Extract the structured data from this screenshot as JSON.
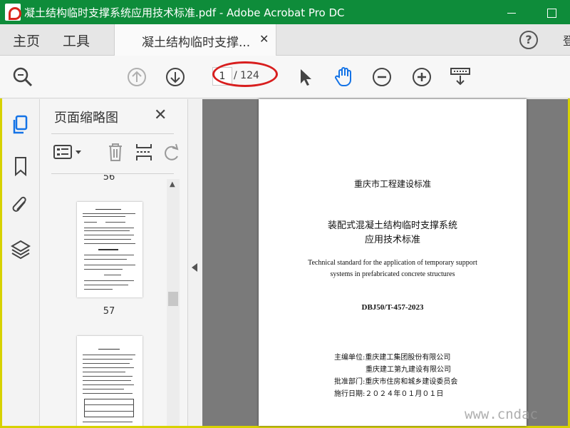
{
  "window": {
    "title": "凝土结构临时支撑系统应用技术标准.pdf - Adobe Acrobat Pro DC"
  },
  "menu": {
    "home": "主页",
    "tools": "工具",
    "doc_tab": "凝土结构临时支撑...",
    "help": "?",
    "login": "登"
  },
  "toolbar": {
    "page_input": "1",
    "page_total": "/ 124"
  },
  "panel": {
    "title": "页面缩略图",
    "close": "✕",
    "thumbnails": [
      {
        "label": "56"
      },
      {
        "label": "57"
      }
    ]
  },
  "document": {
    "standard_org": "重庆市工程建设标准",
    "title_line1": "装配式混凝土结构临时支撑系统",
    "title_line2": "应用技术标准",
    "english_line1": "Technical standard for the application of temporary support",
    "english_line2": "systems in prefabricated concrete structures",
    "code": "DBJ50/T-457-2023",
    "info": [
      "主编单位:重庆建工集团股份有限公司",
      "重庆建工第九建设有限公司",
      "批准部门:重庆市住房和城乡建设委员会",
      "施行日期:２０２４年０１月０１日"
    ]
  },
  "watermark": "www.cndac",
  "colors": {
    "titlebar": "#0e8c3a",
    "annotation": "#d81e1e",
    "accent_blue": "#1473e6"
  }
}
